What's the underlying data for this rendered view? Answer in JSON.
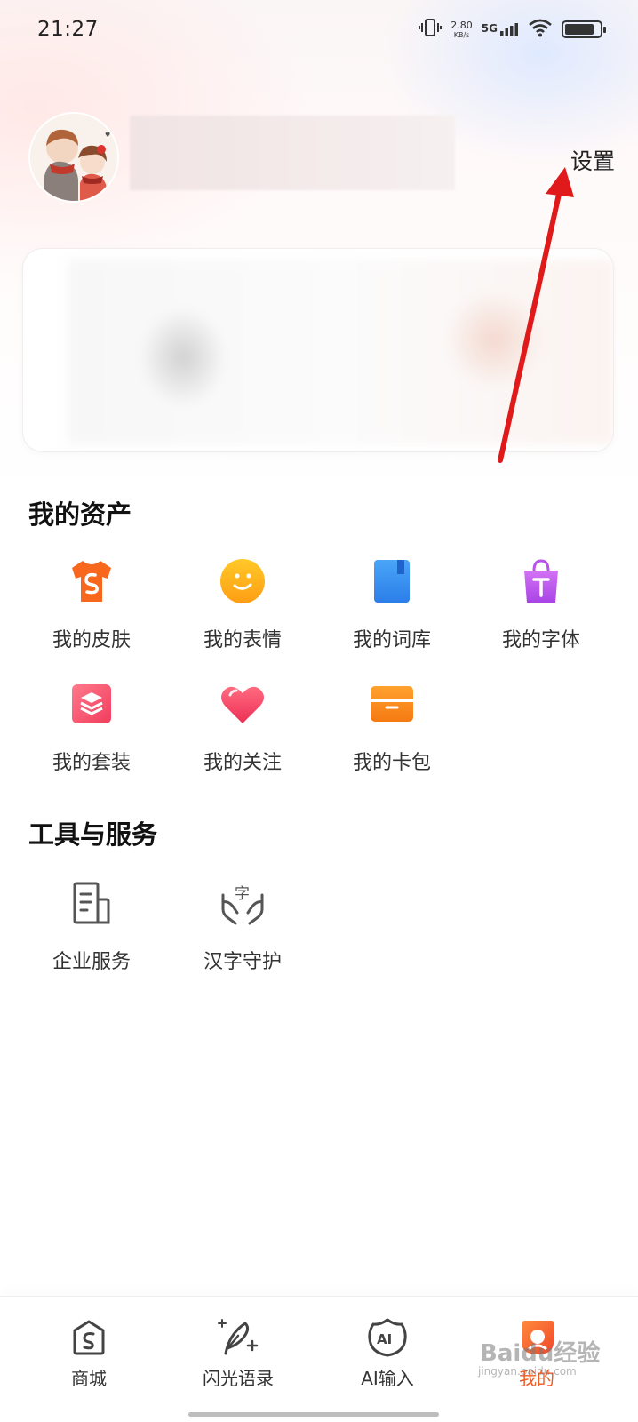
{
  "status_bar": {
    "time": "21:27",
    "net_speed": "2.80",
    "net_unit": "KB/s",
    "network": "5G",
    "battery_level": 0.85
  },
  "profile": {
    "settings_label": "设置"
  },
  "assets": {
    "title": "我的资产",
    "items": [
      {
        "label": "我的皮肤",
        "icon": "tshirt-icon",
        "color": "#f7681e"
      },
      {
        "label": "我的表情",
        "icon": "smiley-icon",
        "color": "#ffb21c"
      },
      {
        "label": "我的词库",
        "icon": "book-icon",
        "color": "#3a8bf0"
      },
      {
        "label": "我的字体",
        "icon": "shopping-bag-font-icon",
        "color": "#c85cf0"
      },
      {
        "label": "我的套装",
        "icon": "layers-icon",
        "color": "#f2506e"
      },
      {
        "label": "我的关注",
        "icon": "heart-icon",
        "color": "#f2506e"
      },
      {
        "label": "我的卡包",
        "icon": "card-wallet-icon",
        "color": "#f78a1e"
      }
    ]
  },
  "tools": {
    "title": "工具与服务",
    "items": [
      {
        "label": "企业服务",
        "icon": "document-icon"
      },
      {
        "label": "汉字守护",
        "icon": "hands-character-icon"
      }
    ]
  },
  "bottom_nav": {
    "items": [
      {
        "label": "商城",
        "icon": "shop-icon"
      },
      {
        "label": "闪光语录",
        "icon": "feather-sparkle-icon"
      },
      {
        "label": "AI输入",
        "icon": "ai-icon"
      },
      {
        "label": "我的",
        "icon": "my-icon",
        "active": true
      }
    ],
    "accent": "#f05a24"
  },
  "watermark": {
    "text": "Baidu经验",
    "sub": "jingyan.baidu.com"
  }
}
